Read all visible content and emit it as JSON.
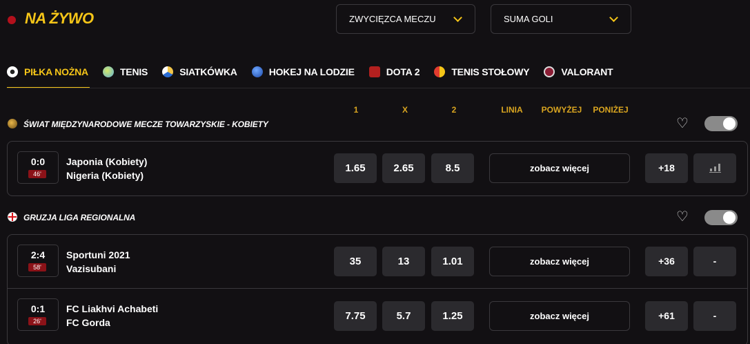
{
  "header": {
    "title": "NA ŻYWO"
  },
  "filters": [
    {
      "label": "ZWYCIĘZCA MECZU"
    },
    {
      "label": "SUMA GOLI"
    }
  ],
  "tabs": [
    {
      "label": "PIŁKA NOŻNA",
      "icon": "football-icon",
      "active": true
    },
    {
      "label": "TENIS",
      "icon": "tennis-icon"
    },
    {
      "label": "SIATKÓWKA",
      "icon": "volleyball-icon"
    },
    {
      "label": "HOKEJ NA LODZIE",
      "icon": "hockey-icon"
    },
    {
      "label": "DOTA 2",
      "icon": "dota-icon"
    },
    {
      "label": "TENIS STOŁOWY",
      "icon": "table-tennis-icon"
    },
    {
      "label": "VALORANT",
      "icon": "valorant-icon"
    }
  ],
  "columns": {
    "c1": "1",
    "cx": "X",
    "c2": "2",
    "line": "LINIA",
    "over": "POWYŻEJ",
    "under": "PONIŻEJ"
  },
  "leagues": [
    {
      "name": "ŚWIAT MIĘDZYNARODOWE MECZE TOWARZYSKIE - KOBIETY",
      "icon": "globe-icon",
      "matches": [
        {
          "score": "0:0",
          "minute": "46'",
          "home": "Japonia (Kobiety)",
          "away": "Nigeria (Kobiety)",
          "odds": [
            "1.65",
            "2.65",
            "8.5"
          ],
          "more": "zobacz więcej",
          "extra": "+18",
          "stat": "stats-icon"
        }
      ]
    },
    {
      "name": "GRUZJA LIGA REGIONALNA",
      "icon": "georgia-flag-icon",
      "matches": [
        {
          "score": "2:4",
          "minute": "58'",
          "home": "Sportuni 2021",
          "away": "Vazisubani",
          "odds": [
            "35",
            "13",
            "1.01"
          ],
          "more": "zobacz więcej",
          "extra": "+36",
          "stat": "-"
        },
        {
          "score": "0:1",
          "minute": "26'",
          "home": "FC Liakhvi Achabeti",
          "away": "FC Gorda",
          "odds": [
            "7.75",
            "5.7",
            "1.25"
          ],
          "more": "zobacz więcej",
          "extra": "+61",
          "stat": "-"
        }
      ]
    }
  ],
  "colors": {
    "accent": "#f5c518",
    "live": "#b3101c",
    "background": "#121013",
    "button": "#2b2a2e"
  }
}
